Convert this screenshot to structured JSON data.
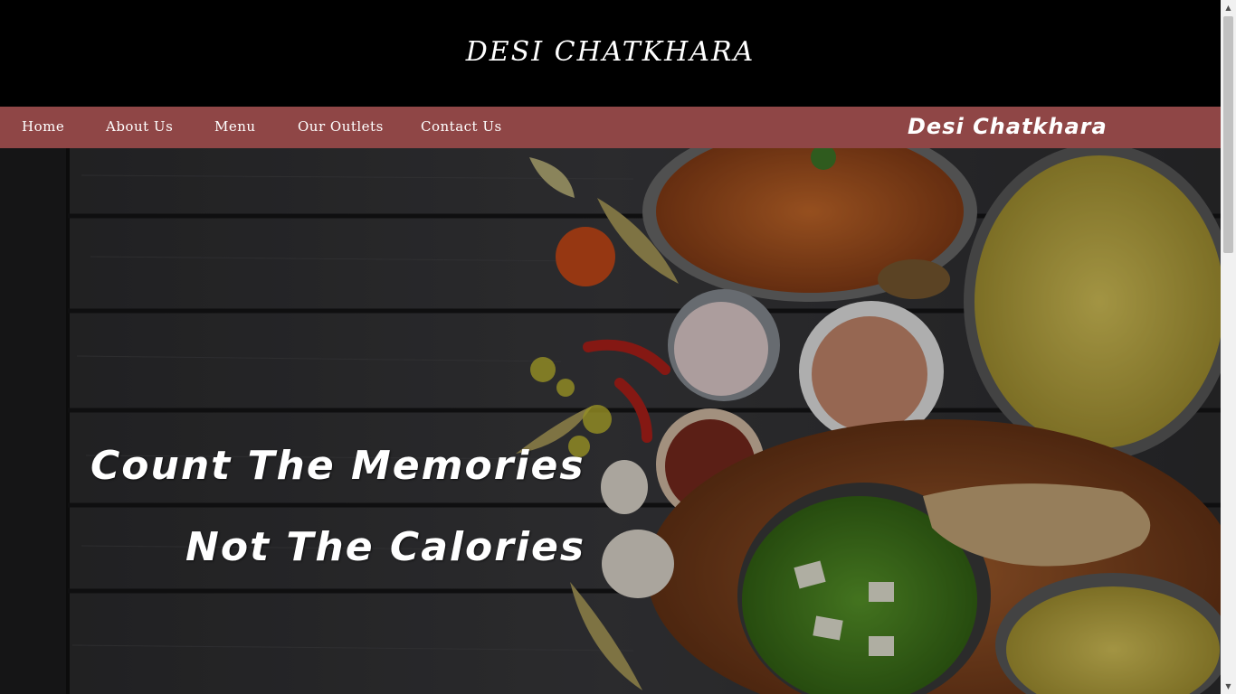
{
  "header": {
    "title": "DESI CHATKHARA"
  },
  "nav": {
    "items": [
      {
        "label": "Home"
      },
      {
        "label": "About Us"
      },
      {
        "label": "Menu"
      },
      {
        "label": "Our Outlets"
      },
      {
        "label": "Contact Us"
      }
    ],
    "brand": "Desi Chatkhara",
    "background": "#8f4646"
  },
  "hero": {
    "line1": "Count The Memories",
    "line2": "Not The Calories"
  },
  "scrollbar": {
    "up_icon": "triangle-up",
    "down_icon": "triangle-down"
  }
}
